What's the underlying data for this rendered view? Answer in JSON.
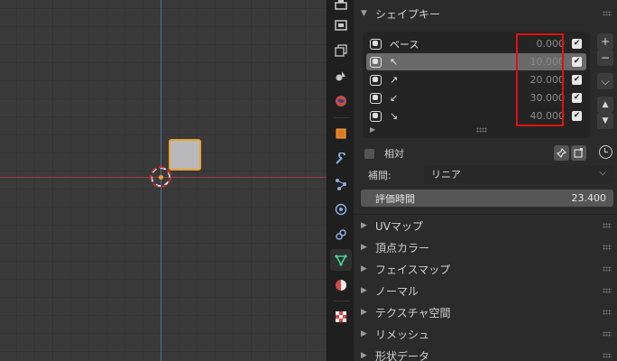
{
  "shape_keys": {
    "title": "シェイプキー",
    "items": [
      {
        "name": "ベース",
        "value": "0.000",
        "checked": true,
        "selected": false
      },
      {
        "name": "↖",
        "value": "10.000",
        "checked": true,
        "selected": true
      },
      {
        "name": "↗",
        "value": "20.000",
        "checked": true,
        "selected": false
      },
      {
        "name": "↙",
        "value": "30.000",
        "checked": true,
        "selected": false
      },
      {
        "name": "↘",
        "value": "40.000",
        "checked": true,
        "selected": false
      }
    ],
    "relative_label": "相対",
    "interpolation_label": "補間:",
    "interpolation_value": "リニア",
    "eval_time_label": "評価時間",
    "eval_time_value": "23.400"
  },
  "collapsed_panels": [
    "UVマップ",
    "頂点カラー",
    "フェイスマップ",
    "ノーマル",
    "テクスチャ空間",
    "リメッシュ",
    "形状データ"
  ],
  "side_buttons": {
    "add": "+",
    "remove": "−",
    "menu": "⌵",
    "up": "▲",
    "down": "▼"
  },
  "colors": {
    "highlight_box": "#e01010",
    "selected_outline": "#f0a030",
    "x_axis": "#9a3a44",
    "y_axis": "#4e6d9e"
  }
}
